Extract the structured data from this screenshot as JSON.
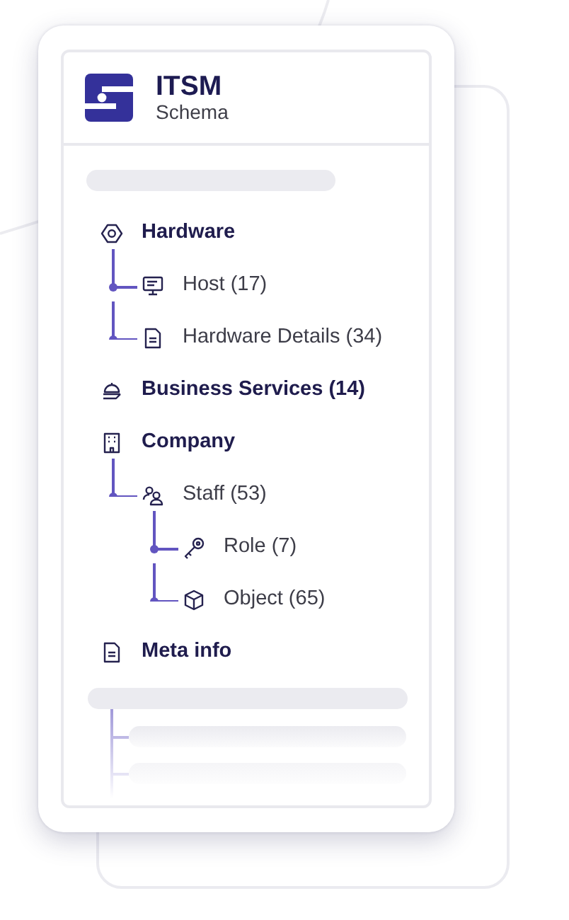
{
  "header": {
    "title": "ITSM",
    "subtitle": "Schema"
  },
  "tree": [
    {
      "label": "Hardware",
      "children": [
        {
          "label": "Host (17)"
        },
        {
          "label": "Hardware Details (34)"
        }
      ]
    },
    {
      "label": "Business Services (14)"
    },
    {
      "label": "Company",
      "children": [
        {
          "label": "Staff (53)",
          "children": [
            {
              "label": "Role (7)"
            },
            {
              "label": "Object (65)"
            }
          ]
        }
      ]
    },
    {
      "label": "Meta info"
    }
  ]
}
